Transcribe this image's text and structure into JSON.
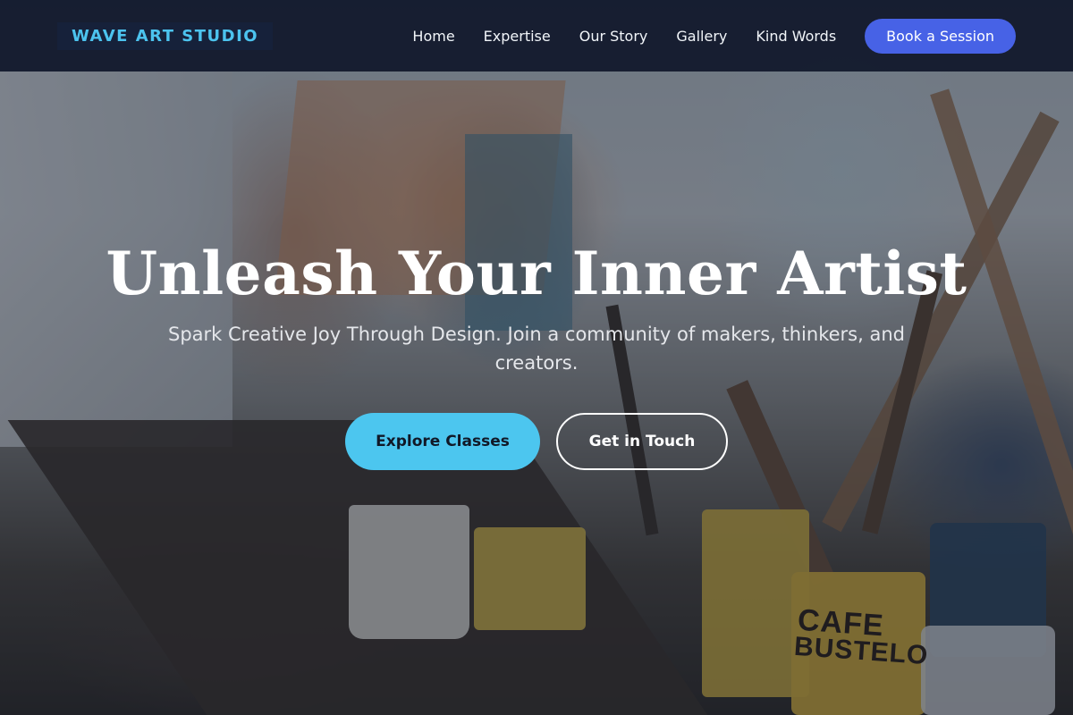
{
  "brand": {
    "name": "WAVE ART STUDIO"
  },
  "nav": {
    "links": [
      "Home",
      "Expertise",
      "Our Story",
      "Gallery",
      "Kind Words"
    ],
    "cta": "Book a Session"
  },
  "hero": {
    "title": "Unleash Your Inner Artist",
    "subtitle": "Spark Creative Joy Through Design. Join a community of makers, thinkers, and creators.",
    "primary_button": "Explore Classes",
    "secondary_button": "Get in Touch",
    "background_text": [
      "CAFE",
      "BUSTELO"
    ]
  },
  "colors": {
    "navbar_bg": "#0f172a",
    "brand_text": "#4cc3ee",
    "cta_bg": "#4762e6",
    "primary_button_bg": "#4cc6ef"
  }
}
